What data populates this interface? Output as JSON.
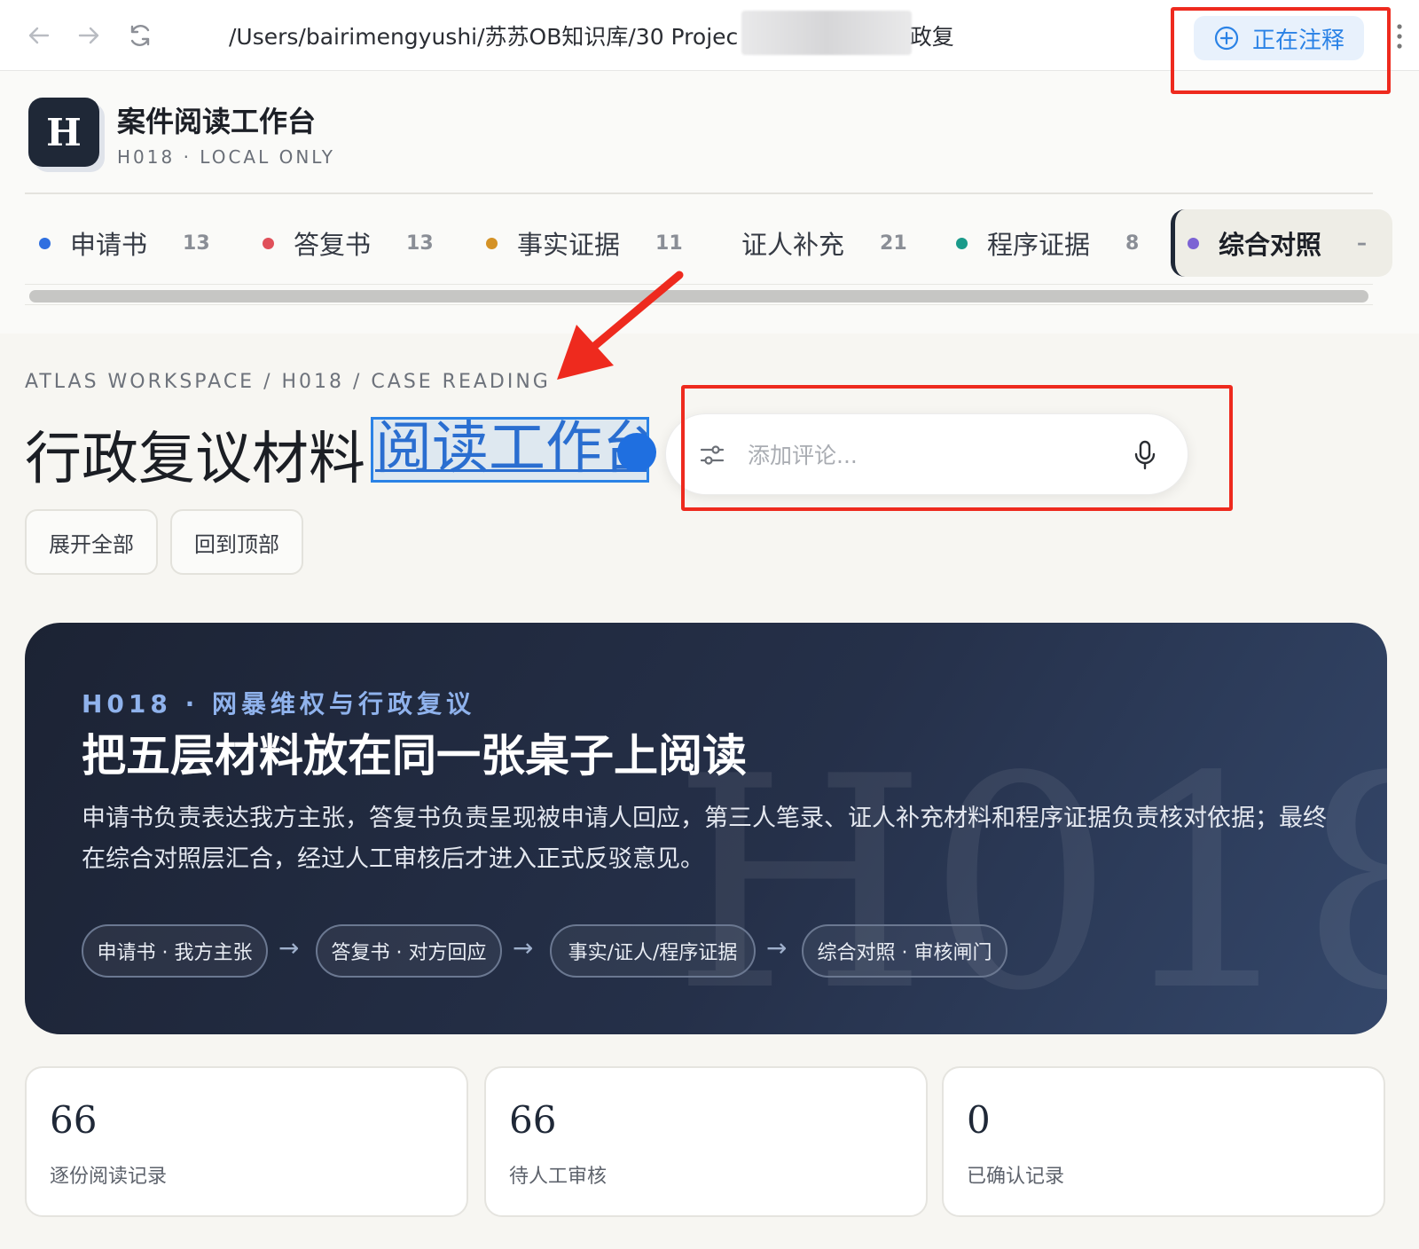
{
  "browser": {
    "address_text": "/Users/bairimengyushi/苏苏OB知识库/30 Projec                -2026.03.04/行政复",
    "annotate_label": "正在注释"
  },
  "app": {
    "logo_letter": "H",
    "title": "案件阅读工作台",
    "subtitle": "H018 · LOCAL ONLY"
  },
  "tabs": [
    {
      "label": "申请书",
      "count": "13",
      "color": "#2f6fe0"
    },
    {
      "label": "答复书",
      "count": "13",
      "color": "#e0505a"
    },
    {
      "label": "事实证据",
      "count": "11",
      "color": "#d49226"
    },
    {
      "label": "证人补充",
      "count": "21",
      "color": ""
    },
    {
      "label": "程序证据",
      "count": "8",
      "color": "#1a9a8a"
    },
    {
      "label": "综合对照",
      "count": "–",
      "color": "#7c63d4"
    }
  ],
  "page": {
    "breadcrumb": "ATLAS WORKSPACE / H018 / CASE READING",
    "title_main": "行政复议材料 ",
    "title_selected": "阅读工作台",
    "comment_placeholder": "添加评论...",
    "expand_all": "展开全部",
    "back_to_top": "回到顶部"
  },
  "hero": {
    "kicker": "H018 · 网暴维权与行政复议",
    "title": "把五层材料放在同一张桌子上阅读",
    "description": "申请书负责表达我方主张，答复书负责呈现被申请人回应，第三人笔录、证人补充材料和程序证据负责核对依据；最终在综合对照层汇合，经过人工审核后才进入正式反驳意见。",
    "watermark": "H018",
    "flow": [
      "申请书 · 我方主张",
      "答复书 · 对方回应",
      "事实/证人/程序证据",
      "综合对照 · 审核闸门"
    ],
    "arrow": "→"
  },
  "stats": [
    {
      "value": "66",
      "label": "逐份阅读记录"
    },
    {
      "value": "66",
      "label": "待人工审核"
    },
    {
      "value": "0",
      "label": "已确认记录"
    }
  ],
  "colors": {
    "annotation_red": "#ee2a1e",
    "accent_blue": "#2a82e6"
  }
}
